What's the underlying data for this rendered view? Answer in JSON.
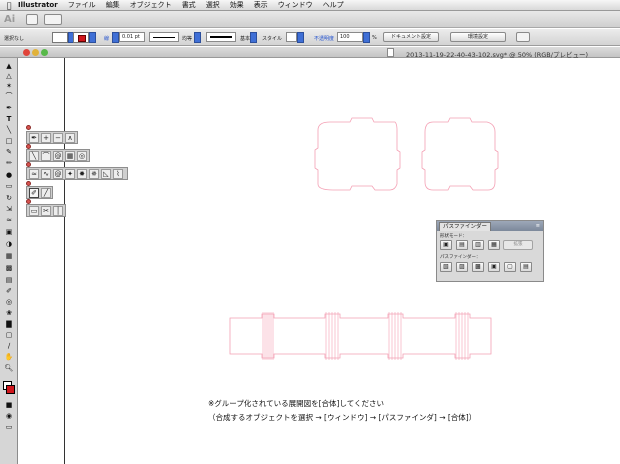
{
  "menubar": {
    "app_name": "Illustrator",
    "items": [
      "ファイル",
      "編集",
      "オブジェクト",
      "書式",
      "選択",
      "効果",
      "表示",
      "ウィンドウ",
      "ヘルプ"
    ]
  },
  "appbar": {
    "logo": "Ai"
  },
  "control_bar": {
    "selection_label": "選択なし",
    "stroke_label": "線",
    "stroke_weight": "0.01 pt",
    "profile_label": "均等",
    "brush_label": "基本",
    "style_label": "スタイル",
    "opacity_label": "不透明度",
    "opacity_value": "100",
    "opacity_unit": "%",
    "doc_setup_button": "ドキュメント設定",
    "prefs_button": "環境設定"
  },
  "document": {
    "title": "2013-11-19-22-40-43-102.svg* @ 50% (RGB/プレビュー)"
  },
  "colors": {
    "accent_blue": "#3f6fd6",
    "stroke_red": "#d0161c",
    "artwork_pink": "#f4a0b4"
  },
  "pathfinder_panel": {
    "tab_label": "パスファインダー",
    "section_shape_modes": "形状モード：",
    "section_pathfinders": "パスファインダー：",
    "expand_button": "拡張"
  },
  "instructions": {
    "line1": "※グループ化されている展開図を[合体]してください",
    "line2": "（合成するオブジェクトを選択 → [ウィンドウ] → [パスファインダ] → [合体]）"
  }
}
